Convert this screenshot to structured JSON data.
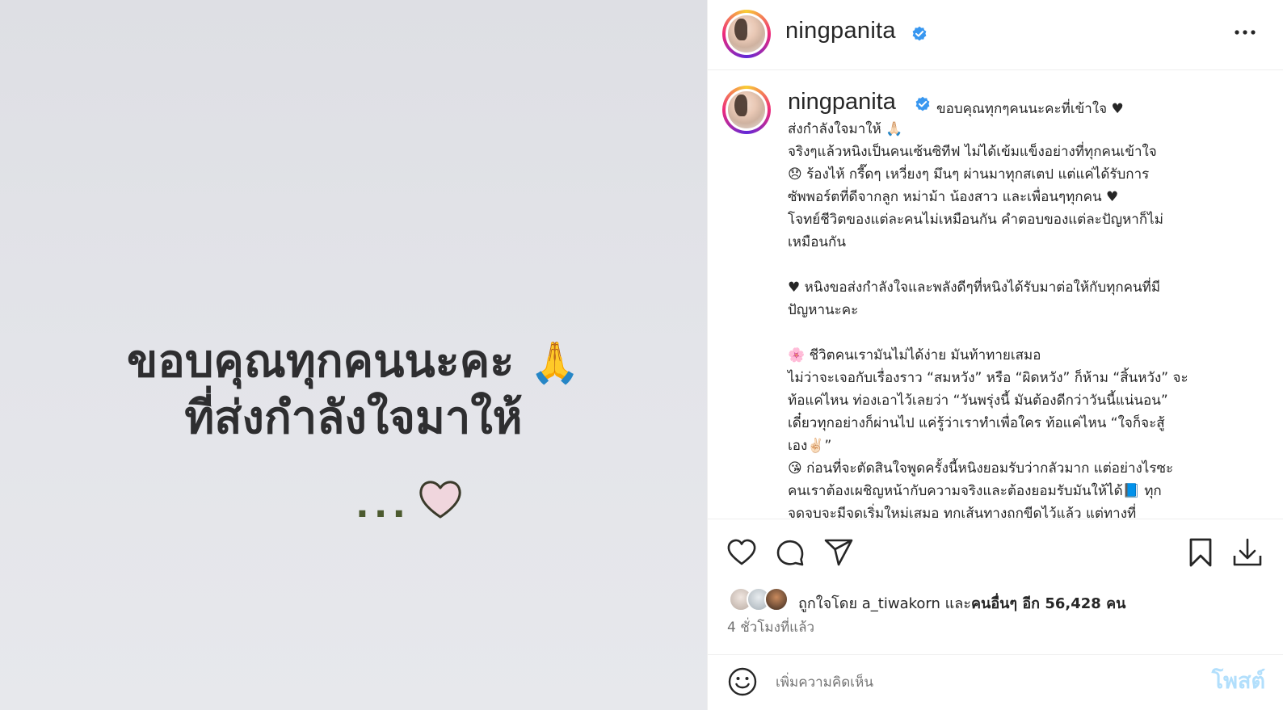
{
  "post_image": {
    "line1": "ขอบคุณทุกคนนะคะ",
    "line1_emoji": "🙏",
    "line2": "ที่ส่งกำลังใจมาให้",
    "dots": "...",
    "background_color": "#e3e4e9"
  },
  "header": {
    "username": "ningpanita",
    "verified": true,
    "more_icon": "more-horizontal-icon"
  },
  "caption": {
    "username": "ningpanita",
    "first_line": "ขอบคุณทุกๆคนนะคะที่เข้าใจ ♥",
    "body": "ส่งกำลังใจมาให้ 🙏🏻\nจริงๆแล้วหนิงเป็นคนเซ้นซิทีฟ ไม่ได้เข้มแข็งอย่างที่ทุกคนเข้าใจ\n😞 ร้องไห้ กรี๊ดๆ เหวี่ยงๆ มึนๆ ผ่านมาทุกสเตป แต่แค่ได้รับการ\nซัพพอร์ตที่ดีจากลูก หม่าม้า น้องสาว และเพื่อนๆทุกคน ♥\nโจทย์ชีวิตของแต่ละคนไม่เหมือนกัน คำตอบของแต่ละปัญหาก็ไม่\nเหมือนกัน\n\n♥ หนิงขอส่งกำลังใจและพลังดีๆที่หนิงได้รับมาต่อให้กับทุกคนที่มี\nปัญหานะคะ\n\n🌸 ชีวิตคนเรามันไม่ได้ง่าย มันท้าทายเสมอ\nไม่ว่าจะเจอกับเรื่องราว “สมหวัง” หรือ “ผิดหวัง” ก็ห้าม “สิ้นหวัง” จะ\nท้อแค่ไหน ท่องเอาไว้เลยว่า “วันพรุ่งนี้ มันต้องดีกว่าวันนี้แน่นอน”\nเดี๋ยวทุกอย่างก็ผ่านไป แค่รู้ว่าเราทำเพื่อใคร ท้อแค่ไหน “ใจก็จะสู้\nเอง✌🏻”\n😘 ก่อนที่จะตัดสินใจพูดครั้งนี้หนิงยอมรับว่ากลัวมาก แต่อย่างไรซะ\nคนเราต้องเผชิญหน้ากับความจริงและต้องยอมรับมันให้ได้📘 ทุก\nจุดจบจะมีจุดเริ่มใหม่เสมอ ทุกเส้นทางถูกขีดไว้แล้ว แต่ทางที่"
  },
  "actions": {
    "like_icon": "heart-icon",
    "comment_icon": "comment-icon",
    "share_icon": "send-icon",
    "save_icon": "bookmark-icon",
    "download_icon": "download-icon"
  },
  "likes": {
    "prefix": "ถูกใจโดย",
    "user": "a_tiwakorn",
    "conjunction": "และ",
    "others": "คนอื่นๆ อีก 56,428 คน"
  },
  "timestamp": "4 ชั่วโมงที่แล้ว",
  "comment": {
    "placeholder": "เพิ่มความคิดเห็น",
    "post_label": "โพสต์"
  },
  "colors": {
    "verified": "#3897f0",
    "post_button_disabled": "#b2dffc",
    "text": "#262626",
    "secondary_text": "#737373"
  }
}
